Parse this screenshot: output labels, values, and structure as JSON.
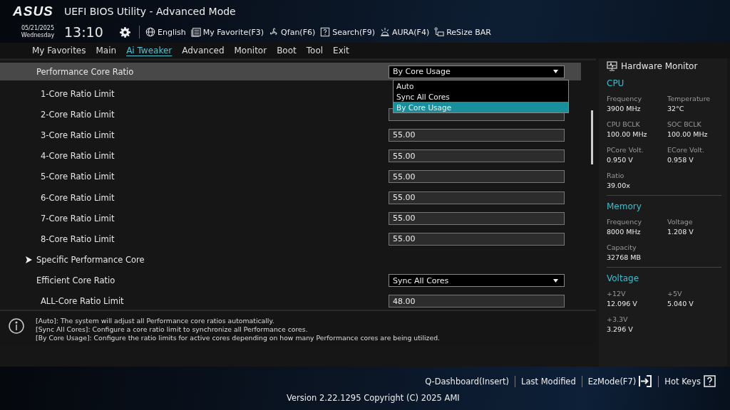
{
  "header": {
    "logo": "ASUS",
    "title": "UEFI BIOS Utility - Advanced Mode",
    "date": "05/21/2025",
    "day": "Wednesday",
    "time": "13:10",
    "toolbar": [
      {
        "kind": "globe",
        "label": "English"
      },
      {
        "kind": "favorite",
        "label": "My Favorite(F3)"
      },
      {
        "kind": "fan",
        "label": "Qfan(F6)"
      },
      {
        "kind": "search",
        "label": "Search(F9)"
      },
      {
        "kind": "aura",
        "label": "AURA(F4)"
      },
      {
        "kind": "bar",
        "label": "ReSize BAR"
      }
    ]
  },
  "tabs": [
    {
      "label": "My Favorites",
      "selected": false
    },
    {
      "label": "Main",
      "selected": false
    },
    {
      "label": "Ai Tweaker",
      "selected": true
    },
    {
      "label": "Advanced",
      "selected": false
    },
    {
      "label": "Monitor",
      "selected": false
    },
    {
      "label": "Boot",
      "selected": false
    },
    {
      "label": "Tool",
      "selected": false
    },
    {
      "label": "Exit",
      "selected": false
    }
  ],
  "settings": [
    {
      "kind": "dropdown",
      "label": "Performance Core Ratio",
      "value": "By Core Usage",
      "selected": true,
      "indented": false,
      "options": [
        {
          "label": "Auto",
          "selected": false
        },
        {
          "label": "Sync All Cores",
          "selected": false
        },
        {
          "label": "By Core Usage",
          "selected": true
        }
      ]
    },
    {
      "kind": "hidden",
      "label": "1-Core Ratio Limit",
      "selected": false,
      "indented": true
    },
    {
      "kind": "field",
      "label": "2-Core Ratio Limit",
      "selected": false,
      "indented": true
    },
    {
      "kind": "field",
      "label": "3-Core Ratio Limit",
      "value": "55.00",
      "selected": false,
      "indented": true
    },
    {
      "kind": "field",
      "label": "4-Core Ratio Limit",
      "value": "55.00",
      "selected": false,
      "indented": true
    },
    {
      "kind": "field",
      "label": "5-Core Ratio Limit",
      "value": "55.00",
      "selected": false,
      "indented": true
    },
    {
      "kind": "field",
      "label": "6-Core Ratio Limit",
      "value": "55.00",
      "selected": false,
      "indented": true
    },
    {
      "kind": "field",
      "label": "7-Core Ratio Limit",
      "value": "55.00",
      "selected": false,
      "indented": true
    },
    {
      "kind": "field",
      "label": "8-Core Ratio Limit",
      "value": "55.00",
      "selected": false,
      "indented": true
    },
    {
      "kind": "submenu",
      "label": "Specific Performance Core",
      "selected": false
    },
    {
      "kind": "dropdown",
      "label": "Efficient Core Ratio",
      "value": "Sync All Cores",
      "selected": false,
      "indented": false
    },
    {
      "kind": "field",
      "label": "ALL-Core Ratio Limit",
      "value": "48.00",
      "selected": false,
      "indented": true
    }
  ],
  "help": [
    "[Auto]: The system will adjust all Performance core ratios automatically.",
    "[Sync All Cores]: Configure a core ratio limit to synchronize all Performance cores.",
    "[By Core Usage]: Configure the ratio limits for active cores depending on how many Performance cores are being utilized."
  ],
  "hardware_monitor": {
    "title": "Hardware Monitor",
    "sections": [
      {
        "title": "CPU",
        "items": [
          {
            "label": "Frequency",
            "value": "3900 MHz"
          },
          {
            "label": "Temperature",
            "value": "32°C"
          },
          {
            "label": "CPU BCLK",
            "value": "100.00 MHz"
          },
          {
            "label": "SOC BCLK",
            "value": "100.00 MHz"
          },
          {
            "label": "PCore Volt.",
            "value": "0.950 V"
          },
          {
            "label": "ECore Volt.",
            "value": "0.958 V"
          },
          {
            "label": "Ratio",
            "value": "39.00x"
          }
        ]
      },
      {
        "title": "Memory",
        "items": [
          {
            "label": "Frequency",
            "value": "8000 MHz"
          },
          {
            "label": "Voltage",
            "value": "1.208 V"
          },
          {
            "label": "Capacity",
            "value": "32768 MB"
          }
        ]
      },
      {
        "title": "Voltage",
        "items": [
          {
            "label": "+12V",
            "value": "12.096 V"
          },
          {
            "label": "+5V",
            "value": "5.040 V"
          },
          {
            "label": "+3.3V",
            "value": "3.296 V"
          }
        ]
      }
    ]
  },
  "footer": {
    "buttons": [
      {
        "kind": "plain",
        "label": "Q-Dashboard(Insert)"
      },
      {
        "kind": "plain",
        "label": "Last Modified"
      },
      {
        "kind": "exit",
        "label": "EzMode(F7)"
      },
      {
        "kind": "help",
        "label": "Hot Keys"
      }
    ],
    "version": "Version 2.22.1295 Copyright (C) 2025 AMI"
  }
}
